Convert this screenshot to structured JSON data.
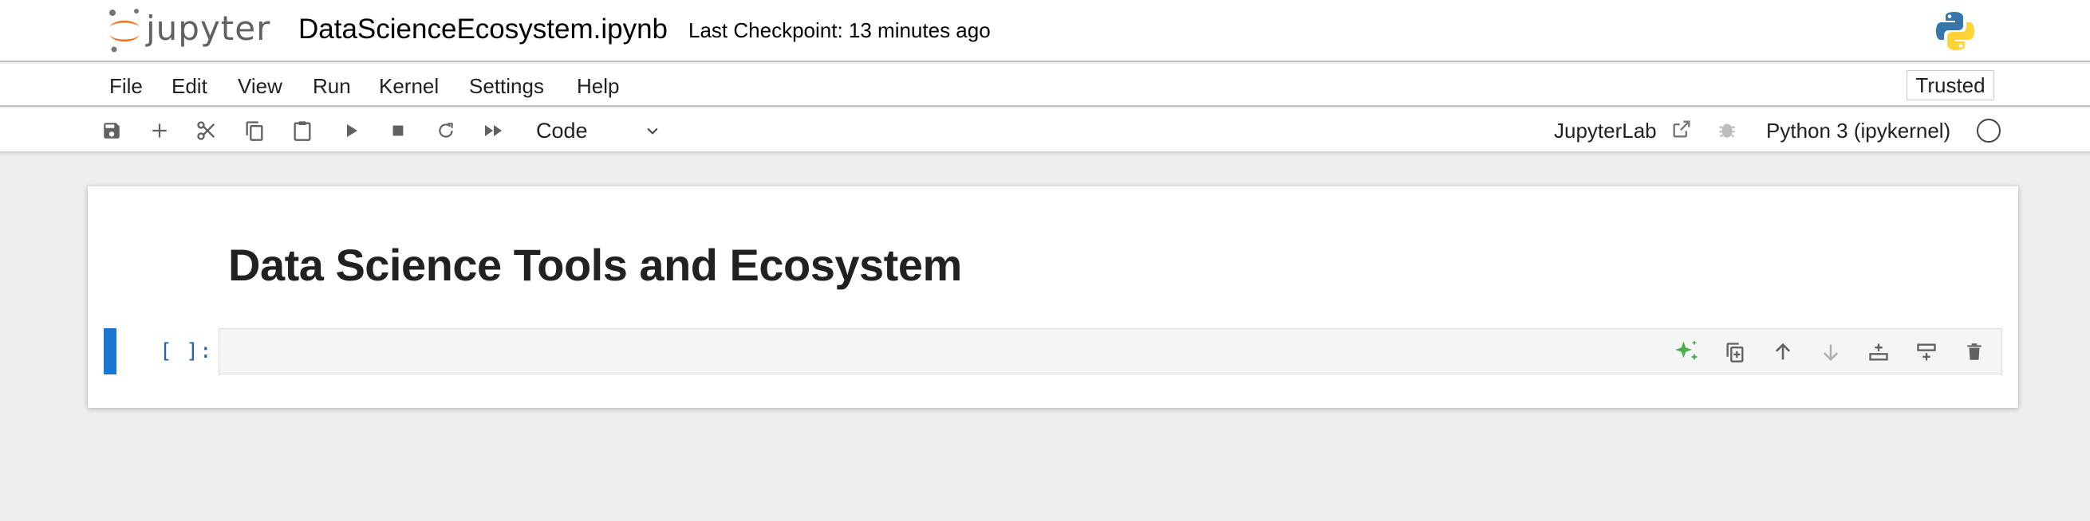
{
  "header": {
    "logo_text": "jupyter",
    "notebook_title": "DataScienceEcosystem.ipynb",
    "checkpoint_text": "Last Checkpoint: 13 minutes ago"
  },
  "menu": {
    "items": [
      "File",
      "Edit",
      "View",
      "Run",
      "Kernel",
      "Settings",
      "Help"
    ],
    "trusted_label": "Trusted"
  },
  "toolbar": {
    "cell_type": "Code",
    "jupyterlab_label": "JupyterLab",
    "kernel_name": "Python 3 (ipykernel)"
  },
  "notebook": {
    "markdown_heading": "Data Science Tools and Ecosystem",
    "code_prompt": "[ ]:"
  },
  "colors": {
    "active_cell_bar": "#1976d2",
    "prompt": "#2f5fa5",
    "ai_sparkle": "#4caf50",
    "jupyter_orange": "#f37726",
    "python_blue": "#3776ab",
    "python_yellow": "#ffd43b"
  }
}
